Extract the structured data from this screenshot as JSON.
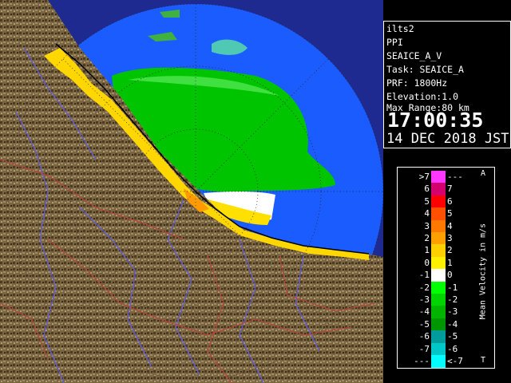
{
  "info": {
    "station": "ilts2",
    "product": "PPI",
    "scan": "SEAICE_A_V",
    "task": "Task: SEAICE_A",
    "prf": "PRF: 1800Hz",
    "elevation": "Elevation:1.0",
    "max_range": "Max Range:80 km",
    "time": "17:00:35",
    "date": "14 DEC 2018 JST"
  },
  "legend": {
    "title": "Mean Velocity in m/s",
    "top_marker": "A",
    "bottom_marker": "T",
    "rows": [
      {
        "left": ">7",
        "right": "---",
        "color": "#ff38ff"
      },
      {
        "left": "6",
        "right": "7",
        "color": "#d4006e"
      },
      {
        "left": "5",
        "right": "6",
        "color": "#ff0000"
      },
      {
        "left": "4",
        "right": "5",
        "color": "#ff5000"
      },
      {
        "left": "3",
        "right": "4",
        "color": "#ff7800"
      },
      {
        "left": "2",
        "right": "3",
        "color": "#ffa000"
      },
      {
        "left": "1",
        "right": "2",
        "color": "#ffd000"
      },
      {
        "left": "0",
        "right": "1",
        "color": "#fff000"
      },
      {
        "left": "-1",
        "right": "0",
        "color": "#ffffff"
      },
      {
        "left": "-2",
        "right": "-1",
        "color": "#00ff00"
      },
      {
        "left": "-3",
        "right": "-2",
        "color": "#00d400"
      },
      {
        "left": "-4",
        "right": "-3",
        "color": "#00b400"
      },
      {
        "left": "-5",
        "right": "-4",
        "color": "#009600"
      },
      {
        "left": "-6",
        "right": "-5",
        "color": "#009c9c"
      },
      {
        "left": "-7",
        "right": "-6",
        "color": "#00c8c8"
      },
      {
        "left": "---",
        "right": "<-7",
        "color": "#00ffff"
      }
    ]
  },
  "map": {
    "land_color": "#7a6543",
    "sea_echo_color": "#1a5cff",
    "outer_sea_color": "#1e2a8f",
    "river_color": "#5a5aff",
    "border_color": "#c0403a"
  }
}
